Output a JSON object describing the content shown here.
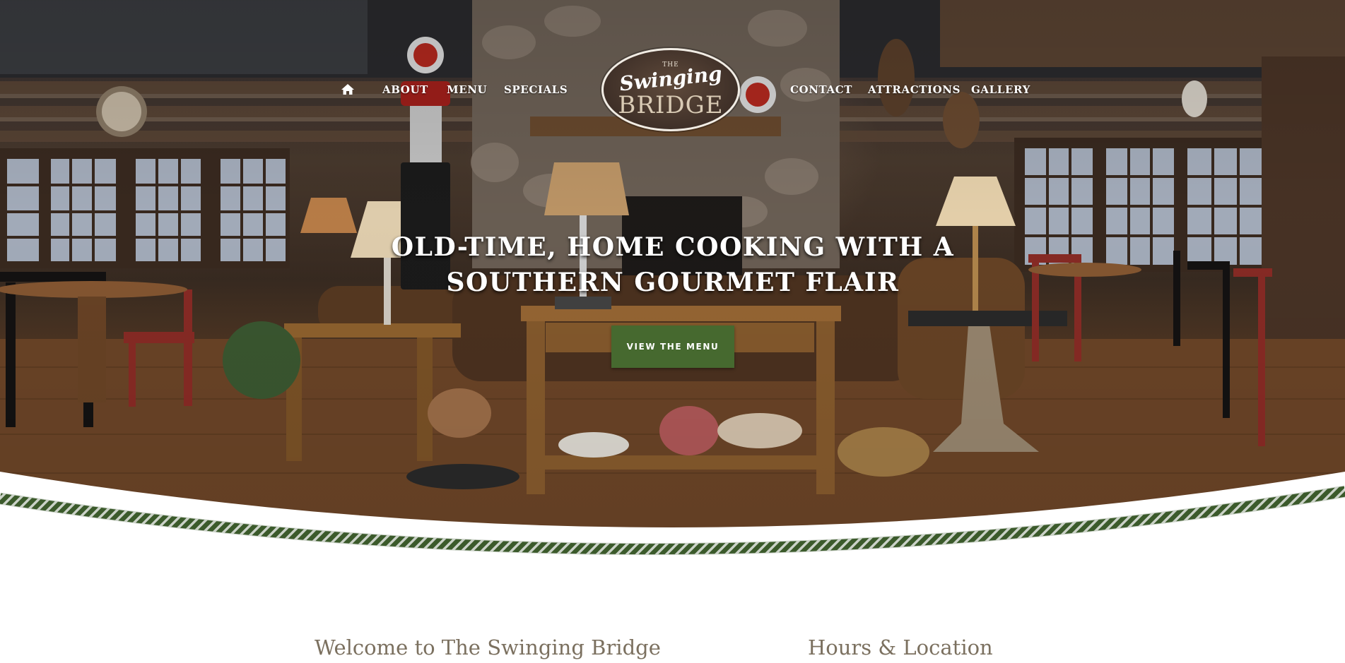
{
  "nav": {
    "home_icon": "home-icon",
    "left": [
      "About",
      "Menu",
      "Specials"
    ],
    "right": [
      "Contact",
      "Attractions",
      "Gallery"
    ]
  },
  "logo": {
    "the": "THE",
    "script": "Swinging",
    "big": "BRIDGE"
  },
  "hero": {
    "headline_line1": "OLD-TIME, HOME COOKING WITH A",
    "headline_line2": "SOUTHERN GOURMET FLAIR",
    "cta_label": "VIEW THE MENU"
  },
  "sections": {
    "welcome_title": "Welcome to The Swinging Bridge",
    "hours_title": "Hours & Location"
  },
  "colors": {
    "accent_green": "#46692f",
    "rope_green": "#3f5f2e",
    "heading_text": "#7b705f"
  }
}
